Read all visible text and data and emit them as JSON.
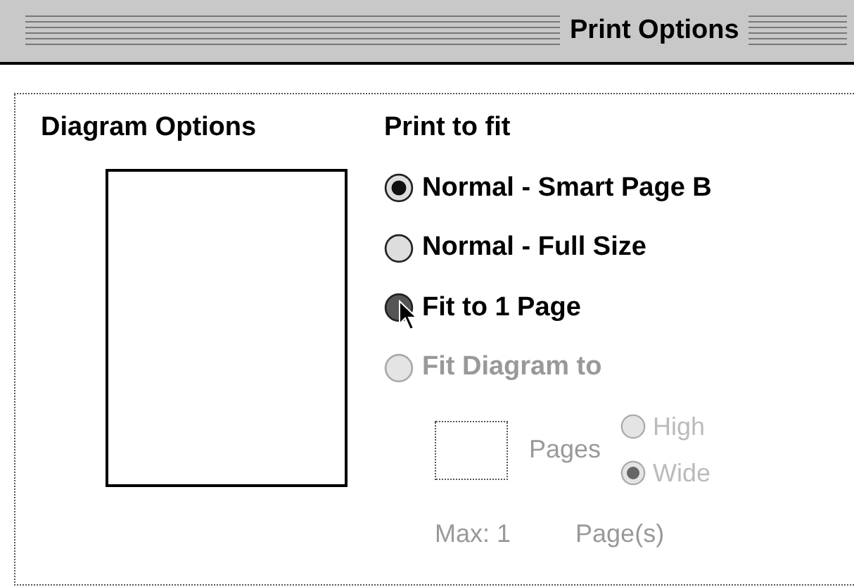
{
  "window": {
    "title": "Print Options"
  },
  "diagram_options": {
    "label": "Diagram Options"
  },
  "print_to_fit": {
    "label": "Print to fit",
    "options": [
      {
        "label": "Normal - Smart Page B",
        "selected": true,
        "pressed": false,
        "disabled": false
      },
      {
        "label": "Normal - Full Size",
        "selected": false,
        "pressed": false,
        "disabled": false
      },
      {
        "label": "Fit to 1 Page",
        "selected": false,
        "pressed": true,
        "disabled": false
      },
      {
        "label": "Fit Diagram to",
        "selected": false,
        "pressed": false,
        "disabled": true
      }
    ]
  },
  "fit_diagram": {
    "pages_label": "Pages",
    "orientation": [
      {
        "label": "High",
        "selected": false,
        "disabled": true
      },
      {
        "label": "Wide",
        "selected": true,
        "disabled": true
      }
    ],
    "max_label": "Max: 1",
    "max_unit": "Page(s)"
  }
}
